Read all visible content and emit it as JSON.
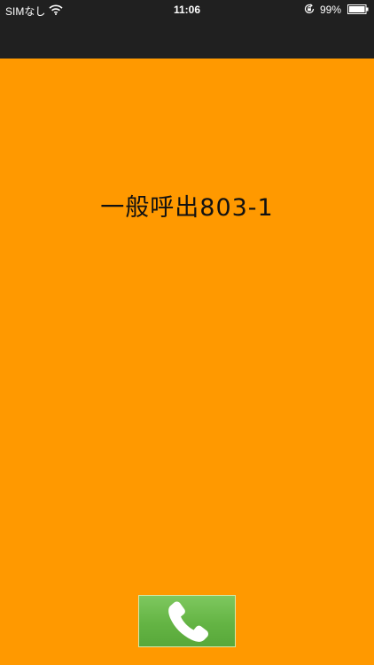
{
  "status_bar": {
    "carrier": "SIMなし",
    "time": "11:06",
    "battery": "99%",
    "icons": [
      "wifi-icon",
      "rotation-lock-icon",
      "battery-icon"
    ]
  },
  "main": {
    "message": "一般呼出803-1",
    "background_color": "#ff9900"
  },
  "call_button": {
    "icon": "phone-icon",
    "color": "#64b444"
  }
}
